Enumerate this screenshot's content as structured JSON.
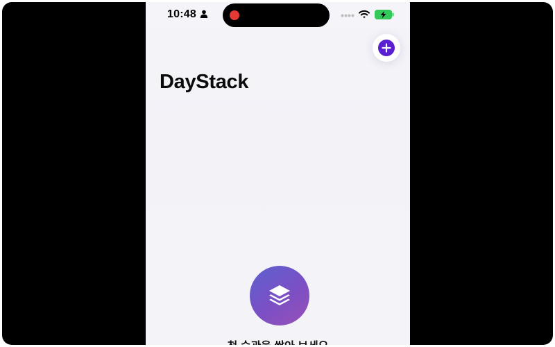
{
  "status_bar": {
    "time": "10:48",
    "icons": [
      "person-icon",
      "recording-indicator",
      "signal-dots-icon",
      "wifi-icon",
      "battery-charging-icon"
    ]
  },
  "header": {
    "title": "DayStack",
    "add_button_icon": "plus-icon"
  },
  "empty_state": {
    "icon": "stack-layers-icon",
    "message": "첫 습관을 쌓아 보세요"
  },
  "colors": {
    "accent": "#5a1fd0",
    "empty_icon_gradient_start": "#5d61cf",
    "empty_icon_gradient_end": "#9a50b8",
    "battery": "#34c759",
    "recording": "#e53935"
  }
}
